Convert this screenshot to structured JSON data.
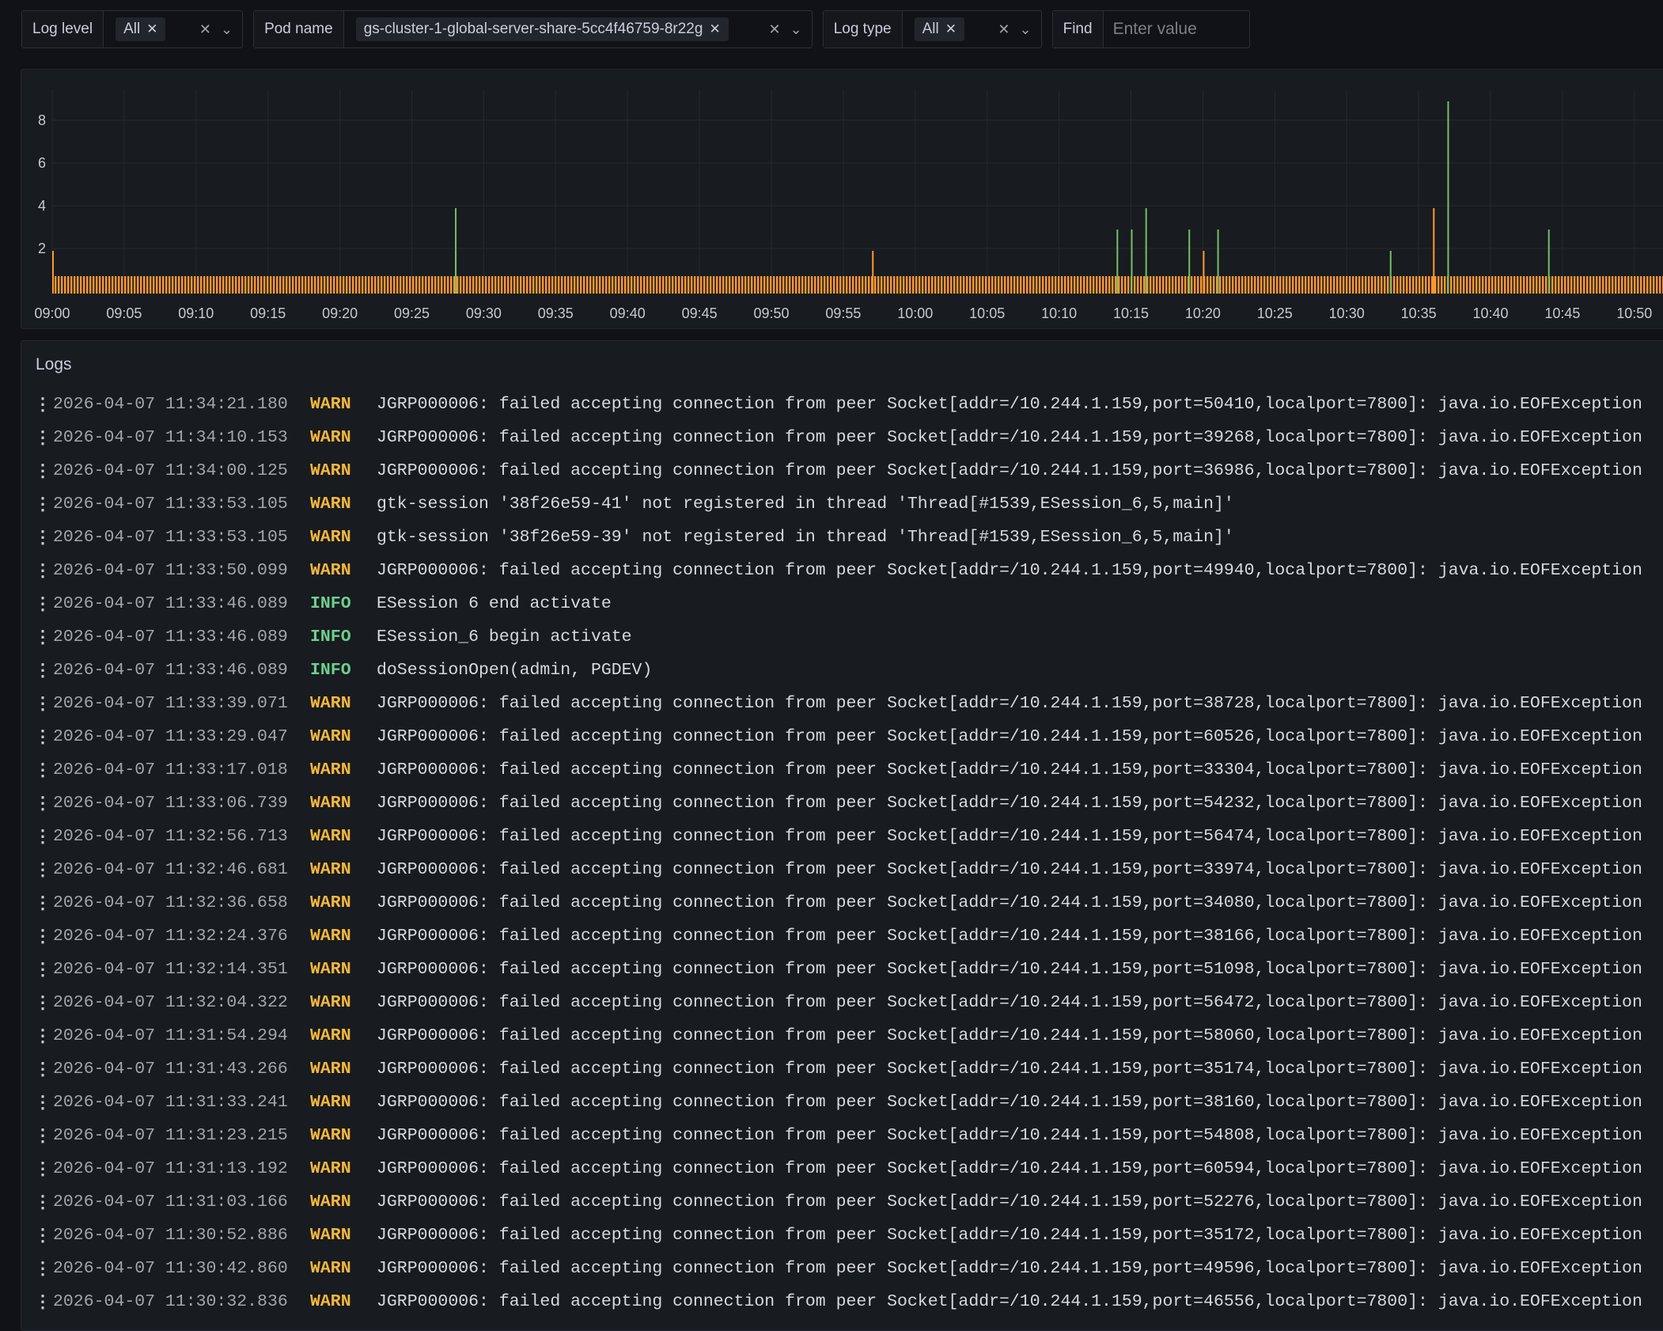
{
  "filters": {
    "log_level": {
      "label": "Log level",
      "chip": "All"
    },
    "pod_name": {
      "label": "Pod name",
      "chip": "gs-cluster-1-global-server-share-5cc4f46759-8r22g"
    },
    "log_type": {
      "label": "Log type",
      "chip": "All"
    },
    "find": {
      "label": "Find",
      "placeholder": "Enter value"
    }
  },
  "chart_data": {
    "type": "bar",
    "xlabel": "",
    "ylabel": "",
    "ylim": [
      0,
      9
    ],
    "y_ticks": [
      2,
      4,
      6,
      8
    ],
    "x_range": [
      "09:00",
      "10:51"
    ],
    "x_ticks": [
      "09:00",
      "09:05",
      "09:10",
      "09:15",
      "09:20",
      "09:25",
      "09:30",
      "09:35",
      "09:40",
      "09:45",
      "09:50",
      "09:55",
      "10:00",
      "10:05",
      "10:10",
      "10:15",
      "10:20",
      "10:25",
      "10:30",
      "10:35",
      "10:40",
      "10:45",
      "10:50"
    ],
    "baseline_value": 1,
    "series": [
      {
        "color": "#ff9830",
        "spikes": [
          {
            "x": "09:00",
            "y": 2
          },
          {
            "x": "09:28",
            "y": 2
          },
          {
            "x": "09:57",
            "y": 2
          },
          {
            "x": "10:20",
            "y": 2
          },
          {
            "x": "10:36",
            "y": 4
          }
        ]
      },
      {
        "color": "#73bf69",
        "spikes": [
          {
            "x": "09:28",
            "y": 4
          },
          {
            "x": "10:14",
            "y": 3
          },
          {
            "x": "10:15",
            "y": 3
          },
          {
            "x": "10:16",
            "y": 4
          },
          {
            "x": "10:19",
            "y": 3
          },
          {
            "x": "10:21",
            "y": 3
          },
          {
            "x": "10:33",
            "y": 2
          },
          {
            "x": "10:37",
            "y": 9
          },
          {
            "x": "10:44",
            "y": 3
          }
        ]
      }
    ]
  },
  "logs": {
    "title": "Logs",
    "rows": [
      {
        "ts": "2026-04-07 11:34:21.180",
        "level": "WARN",
        "msg": "JGRP000006: failed accepting connection from peer Socket[addr=/10.244.1.159,port=50410,localport=7800]: java.io.EOFException"
      },
      {
        "ts": "2026-04-07 11:34:10.153",
        "level": "WARN",
        "msg": "JGRP000006: failed accepting connection from peer Socket[addr=/10.244.1.159,port=39268,localport=7800]: java.io.EOFException"
      },
      {
        "ts": "2026-04-07 11:34:00.125",
        "level": "WARN",
        "msg": "JGRP000006: failed accepting connection from peer Socket[addr=/10.244.1.159,port=36986,localport=7800]: java.io.EOFException"
      },
      {
        "ts": "2026-04-07 11:33:53.105",
        "level": "WARN",
        "msg": "gtk-session '38f26e59-41' not registered in thread 'Thread[#1539,ESession_6,5,main]'"
      },
      {
        "ts": "2026-04-07 11:33:53.105",
        "level": "WARN",
        "msg": "gtk-session '38f26e59-39' not registered in thread 'Thread[#1539,ESession_6,5,main]'"
      },
      {
        "ts": "2026-04-07 11:33:50.099",
        "level": "WARN",
        "msg": "JGRP000006: failed accepting connection from peer Socket[addr=/10.244.1.159,port=49940,localport=7800]: java.io.EOFException"
      },
      {
        "ts": "2026-04-07 11:33:46.089",
        "level": "INFO",
        "msg": "ESession 6 end activate"
      },
      {
        "ts": "2026-04-07 11:33:46.089",
        "level": "INFO",
        "msg": "ESession_6 begin activate"
      },
      {
        "ts": "2026-04-07 11:33:46.089",
        "level": "INFO",
        "msg": "doSessionOpen(admin, PGDEV)"
      },
      {
        "ts": "2026-04-07 11:33:39.071",
        "level": "WARN",
        "msg": "JGRP000006: failed accepting connection from peer Socket[addr=/10.244.1.159,port=38728,localport=7800]: java.io.EOFException"
      },
      {
        "ts": "2026-04-07 11:33:29.047",
        "level": "WARN",
        "msg": "JGRP000006: failed accepting connection from peer Socket[addr=/10.244.1.159,port=60526,localport=7800]: java.io.EOFException"
      },
      {
        "ts": "2026-04-07 11:33:17.018",
        "level": "WARN",
        "msg": "JGRP000006: failed accepting connection from peer Socket[addr=/10.244.1.159,port=33304,localport=7800]: java.io.EOFException"
      },
      {
        "ts": "2026-04-07 11:33:06.739",
        "level": "WARN",
        "msg": "JGRP000006: failed accepting connection from peer Socket[addr=/10.244.1.159,port=54232,localport=7800]: java.io.EOFException"
      },
      {
        "ts": "2026-04-07 11:32:56.713",
        "level": "WARN",
        "msg": "JGRP000006: failed accepting connection from peer Socket[addr=/10.244.1.159,port=56474,localport=7800]: java.io.EOFException"
      },
      {
        "ts": "2026-04-07 11:32:46.681",
        "level": "WARN",
        "msg": "JGRP000006: failed accepting connection from peer Socket[addr=/10.244.1.159,port=33974,localport=7800]: java.io.EOFException"
      },
      {
        "ts": "2026-04-07 11:32:36.658",
        "level": "WARN",
        "msg": "JGRP000006: failed accepting connection from peer Socket[addr=/10.244.1.159,port=34080,localport=7800]: java.io.EOFException"
      },
      {
        "ts": "2026-04-07 11:32:24.376",
        "level": "WARN",
        "msg": "JGRP000006: failed accepting connection from peer Socket[addr=/10.244.1.159,port=38166,localport=7800]: java.io.EOFException"
      },
      {
        "ts": "2026-04-07 11:32:14.351",
        "level": "WARN",
        "msg": "JGRP000006: failed accepting connection from peer Socket[addr=/10.244.1.159,port=51098,localport=7800]: java.io.EOFException"
      },
      {
        "ts": "2026-04-07 11:32:04.322",
        "level": "WARN",
        "msg": "JGRP000006: failed accepting connection from peer Socket[addr=/10.244.1.159,port=56472,localport=7800]: java.io.EOFException"
      },
      {
        "ts": "2026-04-07 11:31:54.294",
        "level": "WARN",
        "msg": "JGRP000006: failed accepting connection from peer Socket[addr=/10.244.1.159,port=58060,localport=7800]: java.io.EOFException"
      },
      {
        "ts": "2026-04-07 11:31:43.266",
        "level": "WARN",
        "msg": "JGRP000006: failed accepting connection from peer Socket[addr=/10.244.1.159,port=35174,localport=7800]: java.io.EOFException"
      },
      {
        "ts": "2026-04-07 11:31:33.241",
        "level": "WARN",
        "msg": "JGRP000006: failed accepting connection from peer Socket[addr=/10.244.1.159,port=38160,localport=7800]: java.io.EOFException"
      },
      {
        "ts": "2026-04-07 11:31:23.215",
        "level": "WARN",
        "msg": "JGRP000006: failed accepting connection from peer Socket[addr=/10.244.1.159,port=54808,localport=7800]: java.io.EOFException"
      },
      {
        "ts": "2026-04-07 11:31:13.192",
        "level": "WARN",
        "msg": "JGRP000006: failed accepting connection from peer Socket[addr=/10.244.1.159,port=60594,localport=7800]: java.io.EOFException"
      },
      {
        "ts": "2026-04-07 11:31:03.166",
        "level": "WARN",
        "msg": "JGRP000006: failed accepting connection from peer Socket[addr=/10.244.1.159,port=52276,localport=7800]: java.io.EOFException"
      },
      {
        "ts": "2026-04-07 11:30:52.886",
        "level": "WARN",
        "msg": "JGRP000006: failed accepting connection from peer Socket[addr=/10.244.1.159,port=35172,localport=7800]: java.io.EOFException"
      },
      {
        "ts": "2026-04-07 11:30:42.860",
        "level": "WARN",
        "msg": "JGRP000006: failed accepting connection from peer Socket[addr=/10.244.1.159,port=49596,localport=7800]: java.io.EOFException"
      },
      {
        "ts": "2026-04-07 11:30:32.836",
        "level": "WARN",
        "msg": "JGRP000006: failed accepting connection from peer Socket[addr=/10.244.1.159,port=46556,localport=7800]: java.io.EOFException"
      }
    ]
  }
}
